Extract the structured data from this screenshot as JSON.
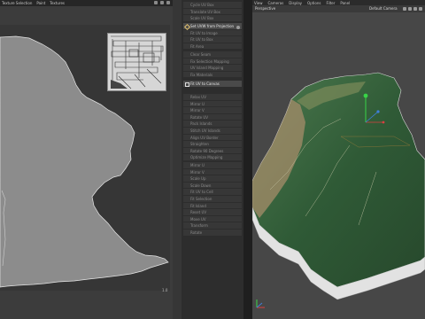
{
  "uv_editor": {
    "menu": [
      "Texture Selection",
      "Paint",
      "Textures"
    ],
    "corner_label": "1.0"
  },
  "center_panel": {
    "commands": [
      {
        "label": "Cycle UV Box",
        "highlight": false
      },
      {
        "label": "Translate UV Box",
        "highlight": false
      },
      {
        "label": "Scale UV Box",
        "highlight": false
      },
      {
        "label": "Set UVW from Projection",
        "highlight": true
      },
      {
        "label": "Fit UV to Image",
        "highlight": false
      },
      {
        "label": "Fit UV to Box",
        "highlight": false
      },
      {
        "label": "Fit Area",
        "highlight": false
      },
      {
        "label": "Clear Seam",
        "highlight": false
      },
      {
        "label": "Fix Selection Mapping",
        "highlight": false
      },
      {
        "label": "UV Island Mapping",
        "highlight": false
      },
      {
        "label": "Fix Materials",
        "highlight": false
      },
      {
        "label": "Fit UV to Canvas",
        "highlight": true
      },
      {
        "label": "Relax UV",
        "highlight": false
      },
      {
        "label": "Mirror U",
        "highlight": false
      },
      {
        "label": "Mirror V",
        "highlight": false
      },
      {
        "label": "Rotate UV",
        "highlight": false
      },
      {
        "label": "Pack Islands",
        "highlight": false
      },
      {
        "label": "Stitch UV Islands",
        "highlight": false
      },
      {
        "label": "Align UV Border",
        "highlight": false
      },
      {
        "label": "Straighten",
        "highlight": false
      },
      {
        "label": "Rotate 90 Degrees",
        "highlight": false
      },
      {
        "label": "Optimize Mapping",
        "highlight": false
      },
      {
        "label": "Mirror U",
        "highlight": false
      },
      {
        "label": "Mirror V",
        "highlight": false
      },
      {
        "label": "Scale Up",
        "highlight": false
      },
      {
        "label": "Scale Down",
        "highlight": false
      },
      {
        "label": "Fit UV to Cell",
        "highlight": false
      },
      {
        "label": "Fit Selection",
        "highlight": false
      },
      {
        "label": "Fit Island",
        "highlight": false
      },
      {
        "label": "Reset UV",
        "highlight": false
      },
      {
        "label": "Move UV",
        "highlight": false
      },
      {
        "label": "Transform",
        "highlight": false
      },
      {
        "label": "Rotate",
        "highlight": false
      }
    ]
  },
  "viewport": {
    "menu": [
      "View",
      "Cameras",
      "Display",
      "Options",
      "Filter",
      "Panel"
    ],
    "label": "Perspective",
    "camera": "Default Camera"
  },
  "colors": {
    "terrain_green": "#2f5a36",
    "terrain_highlight": "#4f7a52",
    "coast_tan": "#a58c6a",
    "uv_shape": "#8a8a8a",
    "background": "#474747"
  }
}
